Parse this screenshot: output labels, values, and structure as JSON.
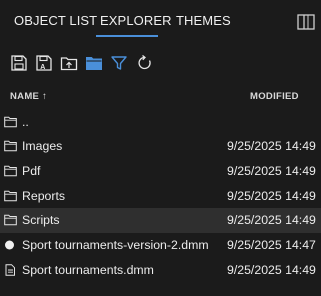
{
  "tabs": [
    {
      "label": "OBJECT LIST",
      "active": false
    },
    {
      "label": "EXPLORER",
      "active": true
    },
    {
      "label": "THEMES",
      "active": false
    }
  ],
  "accent_color": "#4a8fd9",
  "toolbar": {
    "icons": [
      "save-icon",
      "save-as-icon",
      "upload-folder-icon",
      "open-folder-icon",
      "filter-icon",
      "refresh-icon"
    ]
  },
  "columns": {
    "name": "NAME",
    "sort_indicator": "↑",
    "modified": "MODIFIED"
  },
  "rows": [
    {
      "icon": "folder-icon",
      "name": "..",
      "modified": ""
    },
    {
      "icon": "folder-icon",
      "name": "Images",
      "modified": "9/25/2025 14:49"
    },
    {
      "icon": "folder-icon",
      "name": "Pdf",
      "modified": "9/25/2025 14:49"
    },
    {
      "icon": "folder-icon",
      "name": "Reports",
      "modified": "9/25/2025 14:49"
    },
    {
      "icon": "folder-icon",
      "name": "Scripts",
      "modified": "9/25/2025 14:49",
      "selected": true
    },
    {
      "icon": "dot-icon",
      "name": "Sport tournaments-version-2.dmm",
      "modified": "9/25/2025 14:47"
    },
    {
      "icon": "file-icon",
      "name": "Sport tournaments.dmm",
      "modified": "9/25/2025 14:49"
    }
  ]
}
